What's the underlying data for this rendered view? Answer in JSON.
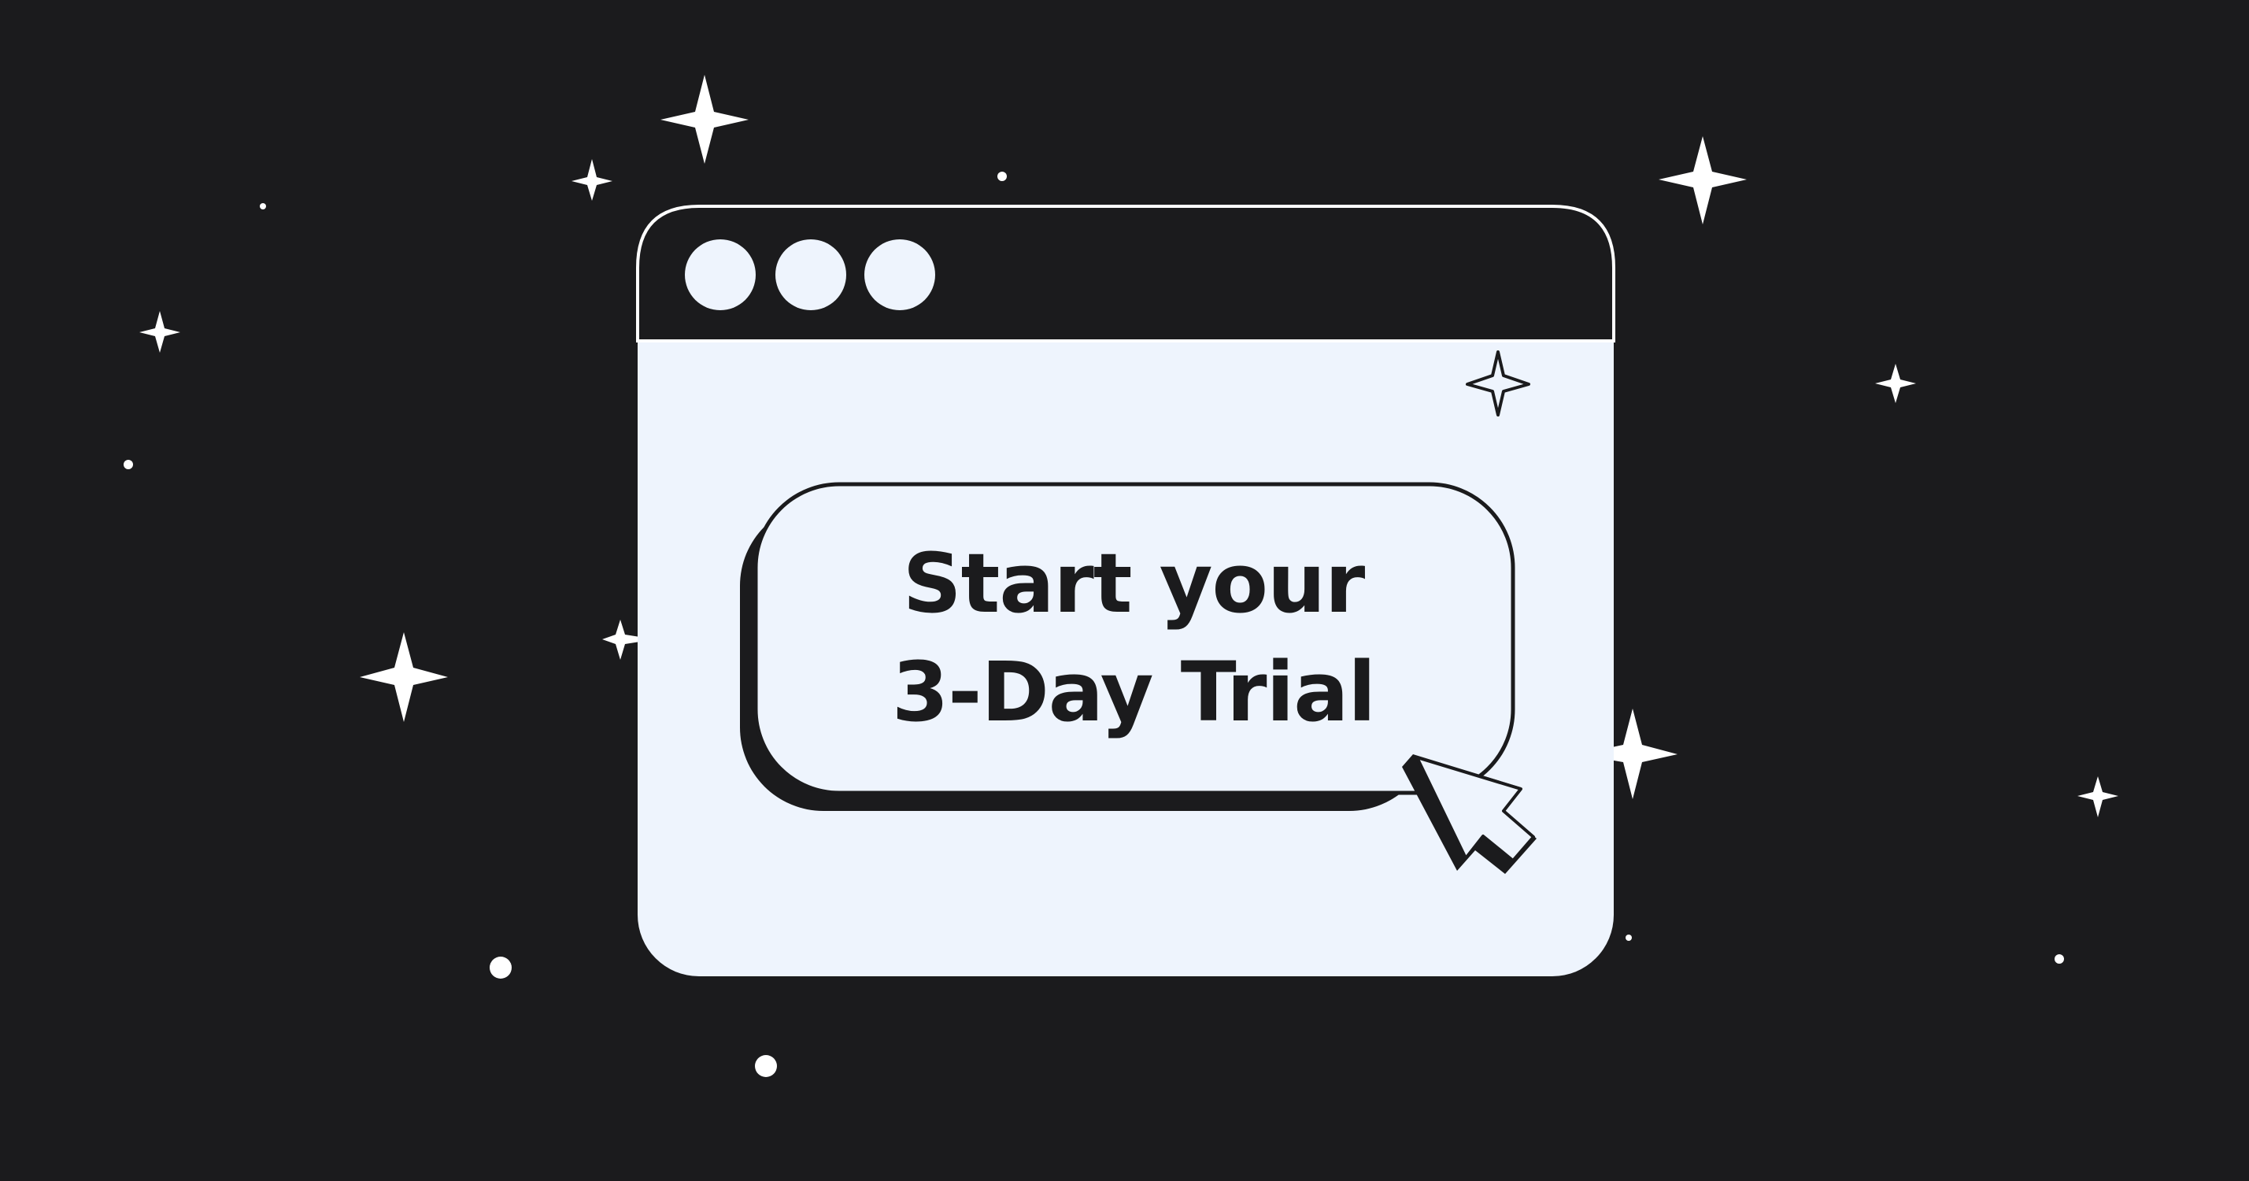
{
  "cta": {
    "line1": "Start your",
    "line2": "3-Day Trial"
  },
  "window": {
    "controls": [
      "dot",
      "dot",
      "dot"
    ]
  },
  "colors": {
    "background": "#1b1b1d",
    "window_body": "#eef4fd",
    "window_titlebar": "#1b1b1d",
    "ink": "#1b1b1d",
    "stars": "#ffffff"
  },
  "icons": {
    "cursor": "arrow-cursor-icon",
    "sparkle": "sparkle-icon",
    "dot": "star-dot-icon"
  }
}
